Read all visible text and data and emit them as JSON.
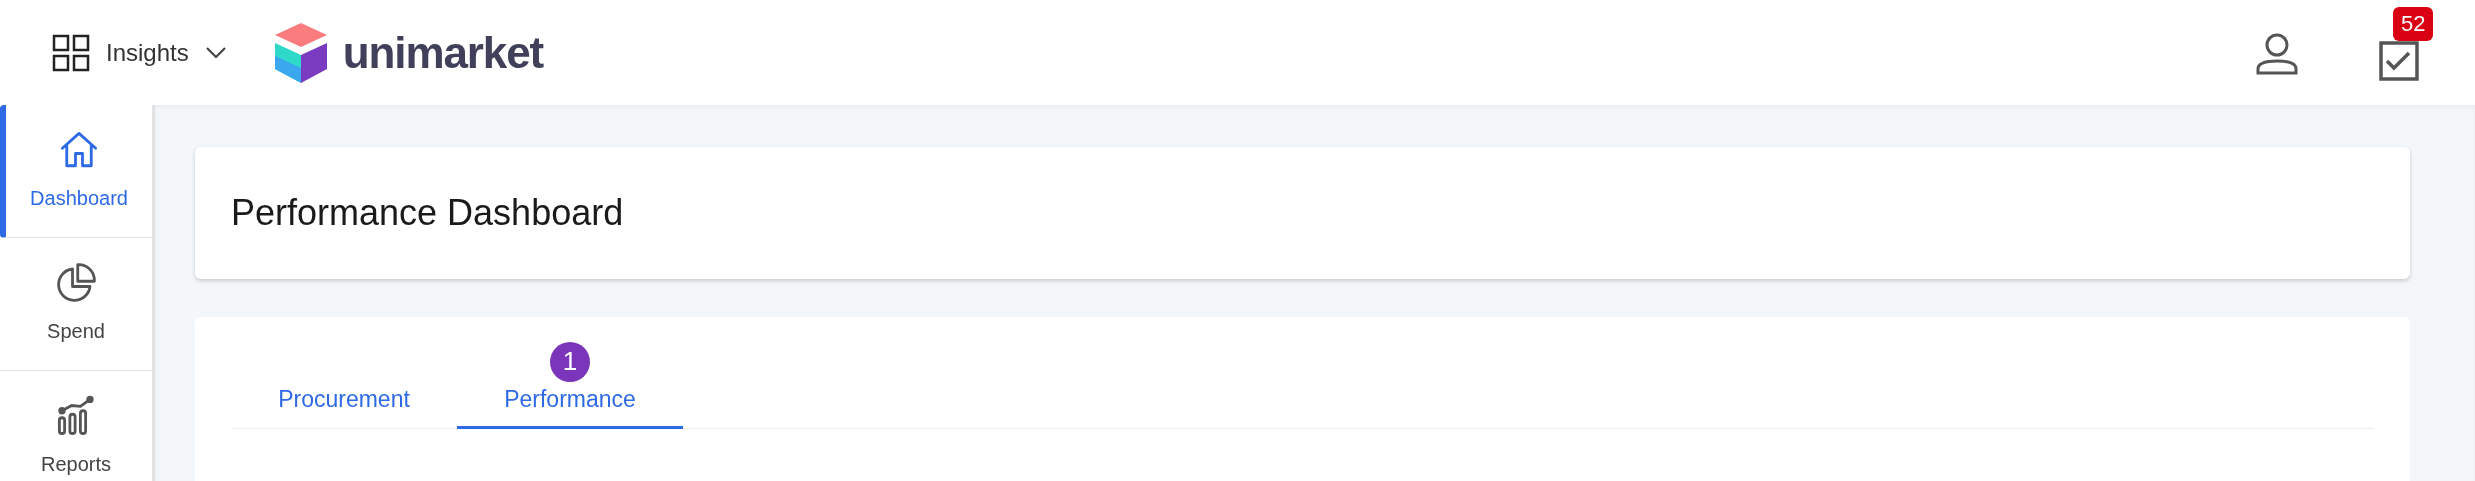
{
  "header": {
    "app_switcher": {
      "label": "Insights"
    },
    "logo": {
      "text": "unimarket"
    },
    "tasks_badge": "52"
  },
  "sidebar": {
    "items": [
      {
        "label": "Dashboard",
        "kind": "home",
        "selected": true
      },
      {
        "label": "Spend",
        "kind": "pie",
        "selected": false
      },
      {
        "label": "Reports",
        "kind": "chart",
        "selected": false
      }
    ]
  },
  "page": {
    "title": "Performance Dashboard",
    "tabs": [
      {
        "label": "Procurement",
        "selected": false
      },
      {
        "label": "Performance",
        "selected": true,
        "badge": "1"
      }
    ]
  }
}
